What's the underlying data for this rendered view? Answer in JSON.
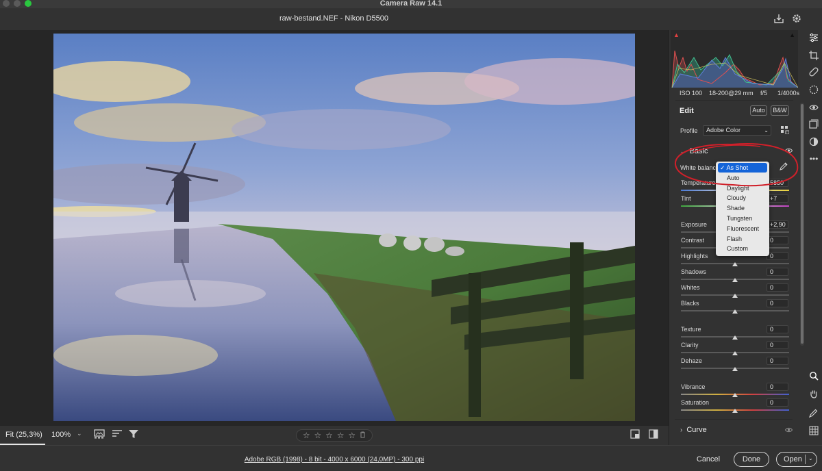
{
  "window": {
    "title": "Camera Raw 14.1"
  },
  "header": {
    "file_title": "raw-bestand.NEF  -  Nikon D5500",
    "save_icon": "save-icon",
    "gear_icon": "gear-icon"
  },
  "exif": {
    "iso": "ISO 100",
    "lens": "18-200@29 mm",
    "aperture": "f/5",
    "shutter": "1/4000s"
  },
  "edit": {
    "title": "Edit",
    "auto_label": "Auto",
    "bw_label": "B&W"
  },
  "profile": {
    "label": "Profile",
    "value": "Adobe Color"
  },
  "basic": {
    "title": "Basic",
    "white_balance_label": "White balance",
    "white_balance_options": [
      "As Shot",
      "Auto",
      "Daylight",
      "Cloudy",
      "Shade",
      "Tungsten",
      "Fluorescent",
      "Flash",
      "Custom"
    ],
    "white_balance_selected": "As Shot",
    "sliders": [
      {
        "label": "Temperature",
        "value": "5850",
        "position": 0.55
      },
      {
        "label": "Tint",
        "value": "+7",
        "position": 0.52
      },
      {
        "label": "Exposure",
        "value": "+2,90",
        "position": 0.79
      },
      {
        "label": "Contrast",
        "value": "0",
        "position": 0.5
      },
      {
        "label": "Highlights",
        "value": "0",
        "position": 0.5
      },
      {
        "label": "Shadows",
        "value": "0",
        "position": 0.5
      },
      {
        "label": "Whites",
        "value": "0",
        "position": 0.5
      },
      {
        "label": "Blacks",
        "value": "0",
        "position": 0.5
      },
      {
        "label": "Texture",
        "value": "0",
        "position": 0.5
      },
      {
        "label": "Clarity",
        "value": "0",
        "position": 0.5
      },
      {
        "label": "Dehaze",
        "value": "0",
        "position": 0.5
      },
      {
        "label": "Vibrance",
        "value": "0",
        "position": 0.5
      },
      {
        "label": "Saturation",
        "value": "0",
        "position": 0.5
      }
    ]
  },
  "curve": {
    "title": "Curve"
  },
  "canvas_toolbar": {
    "zoom_fit": "Fit (25,3%)",
    "zoom_100": "100%"
  },
  "footer": {
    "workflow": "Adobe RGB (1998) - 8 bit - 4000 x 6000 (24,0MP) - 300 ppi",
    "cancel": "Cancel",
    "done": "Done",
    "open": "Open"
  },
  "colors": {
    "accent": "#1464d8",
    "annotation": "#d0202a"
  }
}
